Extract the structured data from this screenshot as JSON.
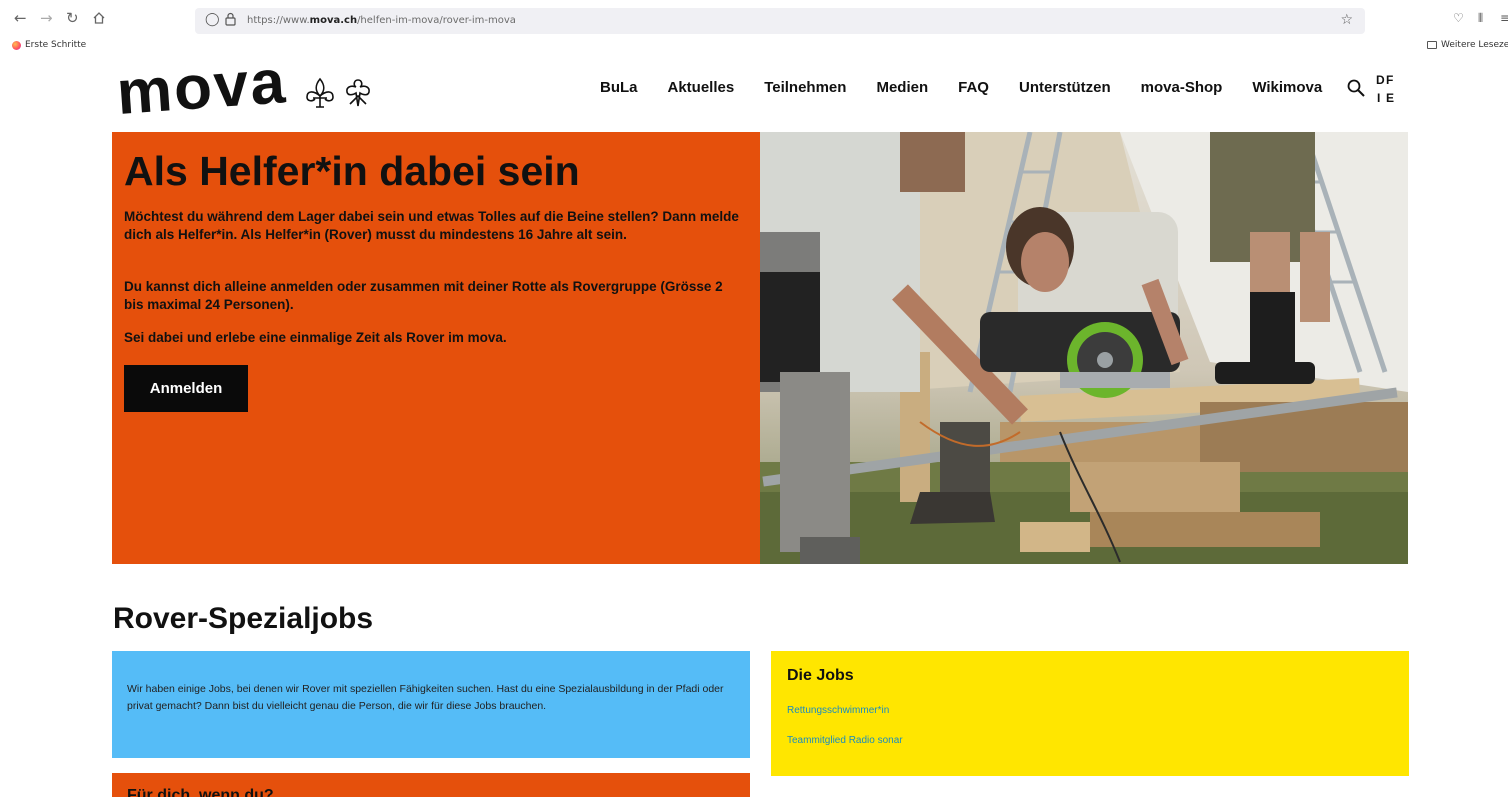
{
  "browser": {
    "url_prefix": "https://www.",
    "url_domain": "mova.ch",
    "url_path": "/helfen-im-mova/rover-im-mova",
    "bookmarks": [
      "Erste Schritte"
    ],
    "other_bookmarks": "Weitere Lesezeich"
  },
  "site": {
    "logo": "mova",
    "nav": [
      "BuLa",
      "Aktuelles",
      "Teilnehmen",
      "Medien",
      "FAQ",
      "Unterstützen",
      "mova-Shop",
      "Wikimova"
    ],
    "languages": [
      "D",
      "F",
      "I",
      "E"
    ]
  },
  "hero": {
    "title": "Als Helfer*in dabei sein",
    "paragraphs": [
      "Möchtest du während dem Lager dabei sein und etwas Tolles auf die Beine stellen? Dann melde dich als Helfer*in. Als Helfer*in (Rover) musst du mindestens 16 Jahre alt sein.",
      "Du kannst dich alleine anmelden oder zusammen mit deiner Rotte als Rovergruppe (Grösse 2 bis maximal 24 Personen).",
      "Sei dabei und erlebe eine einmalige Zeit als Rover im mova."
    ],
    "button": "Anmelden"
  },
  "section": {
    "title": "Rover-Spezialjobs",
    "intro": "Wir haben einige Jobs, bei denen wir Rover mit speziellen Fähigkeiten suchen. Hast du eine Spezialausbildung in der Pfadi oder privat gemacht? Dann bist du vielleicht genau die Person, die wir für diese Jobs brauchen.",
    "jobs_title": "Die Jobs",
    "jobs": [
      "Rettungsschwimmer*in",
      "Teammitglied Radio sonar"
    ],
    "next_title": "Für dich, wenn du?"
  },
  "colors": {
    "orange": "#e5500c",
    "blue": "#55bcf7",
    "yellow": "#ffe600",
    "link": "#1a8cc0"
  }
}
